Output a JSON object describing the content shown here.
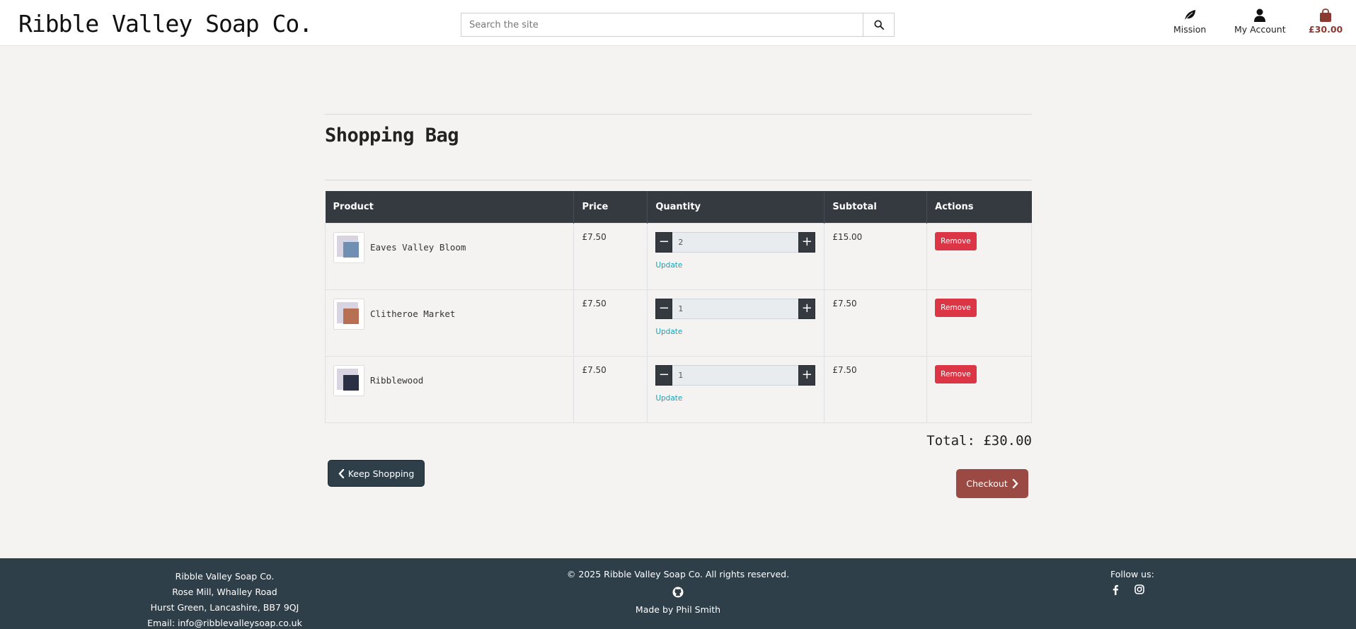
{
  "header": {
    "logo": "Ribble Valley Soap Co.",
    "search_placeholder": "Search the site",
    "nav": {
      "mission": "Mission",
      "account": "My Account",
      "bag_total": "£30.00"
    }
  },
  "page": {
    "title": "Shopping Bag"
  },
  "table": {
    "headers": [
      "Product",
      "Price",
      "Quantity",
      "Subtotal",
      "Actions"
    ],
    "rows": [
      {
        "name": "Eaves Valley Bloom",
        "price": "£7.50",
        "quantity": "2",
        "subtotal": "£15.00",
        "update": "Update",
        "remove": "Remove",
        "swatch": "#6f8fb3"
      },
      {
        "name": "Clitheroe Market",
        "price": "£7.50",
        "quantity": "1",
        "subtotal": "£7.50",
        "update": "Update",
        "remove": "Remove",
        "swatch": "#b87052"
      },
      {
        "name": "Ribblewood",
        "price": "£7.50",
        "quantity": "1",
        "subtotal": "£7.50",
        "update": "Update",
        "remove": "Remove",
        "swatch": "#2b2f45"
      }
    ]
  },
  "summary": {
    "total": "Total: £30.00",
    "keep_shopping": "Keep Shopping",
    "checkout": "Checkout"
  },
  "footer": {
    "address": [
      "Ribble Valley Soap Co.",
      "Rose Mill, Whalley Road",
      "Hurst Green, Lancashire, BB7 9QJ",
      "Email: info@ribblevalleysoap.co.uk"
    ],
    "copyright": "© 2025 Ribble Valley Soap Co. All rights reserved.",
    "made_by": "Made by Phil Smith",
    "follow": "Follow us:"
  },
  "colors": {
    "header_dark": "#343a40",
    "danger": "#dc3545",
    "link": "#17a2b8",
    "checkout": "#9a4a43",
    "footer": "#2f3f4a"
  }
}
